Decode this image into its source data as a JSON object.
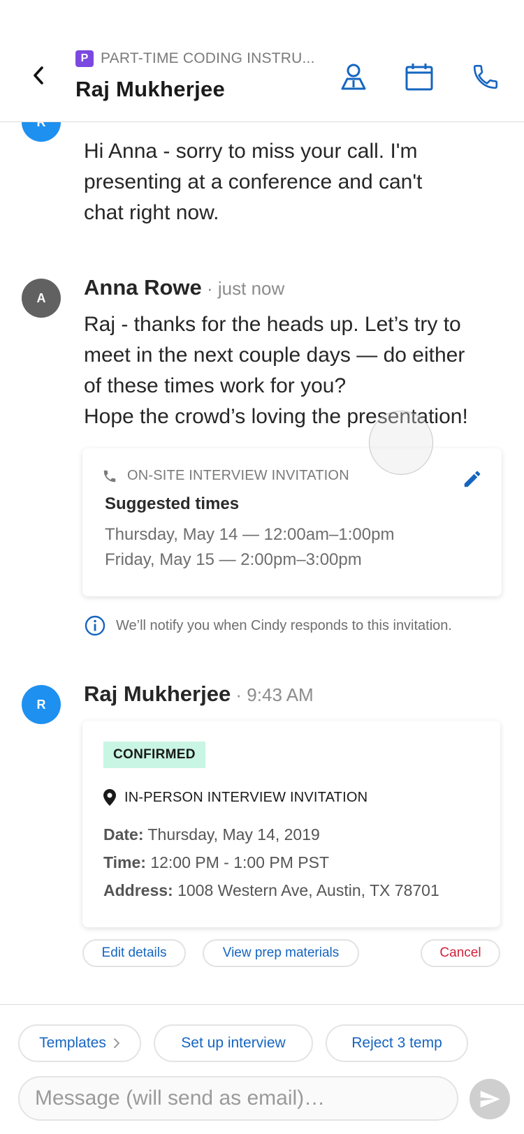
{
  "header": {
    "job_badge": "P",
    "job_title": "PART-TIME CODING INSTRU...",
    "contact_name": "Raj Mukherjee",
    "icons": [
      "back-chevron-icon",
      "profile-icon",
      "calendar-icon",
      "phone-icon"
    ]
  },
  "messages": [
    {
      "avatar": "R",
      "lines": [
        "Hi Anna - sorry to miss your call. I'm",
        "presenting at a conference and can't",
        "chat right now."
      ]
    },
    {
      "avatar": "A",
      "sender": "Anna Rowe",
      "time": " · just now",
      "lines": [
        "Raj - thanks for the heads up. Let’s try to",
        "meet in the next couple days — do either",
        "of these times work for you?",
        "Hope the crowd’s loving the presentation!"
      ],
      "invitation": {
        "heading": "ON-SITE INTERVIEW INVITATION",
        "title": "Suggested times",
        "times": [
          "Thursday, May 14 — 12:00am–1:00pm",
          "Friday, May 15 — 2:00pm–3:00pm"
        ]
      },
      "note": "We’ll notify you when Cindy responds to this invitation."
    },
    {
      "avatar": "R",
      "sender": "Raj Mukherjee",
      "time": " · 9:43 AM",
      "confirmed": {
        "badge": "CONFIRMED",
        "heading": "IN-PERSON INTERVIEW INVITATION",
        "date_label": "Date:",
        "date_value": " Thursday, May 14, 2019",
        "time_label": "Time:",
        "time_value": " 12:00 PM - 1:00 PM PST",
        "address_label": "Address:",
        "address_value": " 1008 Western Ave, Austin, TX 78701"
      },
      "actions": {
        "edit": "Edit details",
        "prep": "View prep materials",
        "cancel": "Cancel"
      }
    }
  ],
  "composer": {
    "templates": "Templates",
    "setup": "Set up interview",
    "reject": "Reject 3 temp",
    "placeholder": "Message (will send as email)…"
  },
  "colors": {
    "accent": "#1565c0",
    "avatar_blue": "#1e90f0",
    "avatar_gray": "#616161",
    "job_badge": "#7b49e0",
    "confirmed_bg": "#c9f5e4",
    "cancel_red": "#d0223a"
  }
}
